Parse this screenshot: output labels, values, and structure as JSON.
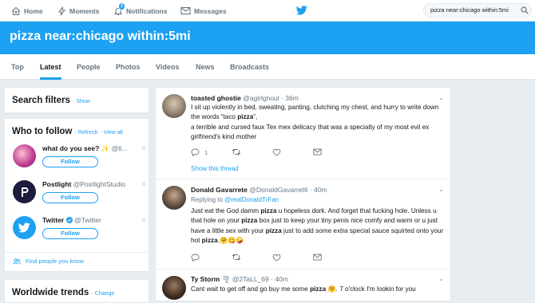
{
  "nav": {
    "home": "Home",
    "moments": "Moments",
    "notifications": "Notifications",
    "notifications_badge": "1",
    "messages": "Messages",
    "search_value": "pizza near:chicago within:5mi"
  },
  "banner": {
    "title": "pizza near:chicago within:5mi"
  },
  "tabs": [
    "Top",
    "Latest",
    "People",
    "Photos",
    "Videos",
    "News",
    "Broadcasts"
  ],
  "search_filters": {
    "title": "Search filters",
    "link": "· Show"
  },
  "who_to_follow": {
    "title": "Who to follow",
    "refresh": "· Refresh",
    "view_all": "· View all",
    "follow_label": "Follow",
    "users": [
      {
        "name": "what do you see? ✨",
        "handle": "@ti...",
        "avatar_color": "#c0398f"
      },
      {
        "name": "Postlight",
        "handle": "@PostlightStudio",
        "avatar_color": "#1c1c3c"
      },
      {
        "name": "Twitter",
        "handle": "@Twitter",
        "avatar_color": "#1da1f2"
      }
    ],
    "find_people": "Find people you know"
  },
  "trends": {
    "title": "Worldwide trends",
    "change": "· Change"
  },
  "tweets": [
    {
      "name": "toasted ghostie",
      "handle": "@agirlghoul",
      "time": "· 36m",
      "text": "I sit up violently in bed, sweating, panting, clutching my chest, and hurry to write down the words “taco pizza”,",
      "text2": "a terrible and cursed faux Tex mex delicacy that was a specialty of my most evil ex girlfriend's kind mother",
      "reply_count": "1",
      "show_thread": "Show this thread",
      "avatar_color": "#8a7a6a"
    },
    {
      "name": "Donald Gavarrete",
      "handle": "@DonaldGavarret6",
      "time": "· 40m",
      "replying_to": "Replying to",
      "replying_handle": "@realDonaldTrFan",
      "text": "Just eat the God damm pizza u hopeless dork. And forget that fucking hole. Unless u that hole on your pizza box just to keep your tiny penis nice comfy and warm or u just have a little sex with your pizza just to add some extra special sauce squirted onto your hot pizza.🤗😋🤪",
      "avatar_color": "#5a4a3c"
    },
    {
      "name": "Ty Storm",
      "handle": "@2TaLL_69",
      "time": "· 40m",
      "text": "Cant wait to get off and go buy me some pizza 🤗. 7 o'clock I'm lookin for you",
      "avatar_color": "#3c2c20"
    }
  ]
}
